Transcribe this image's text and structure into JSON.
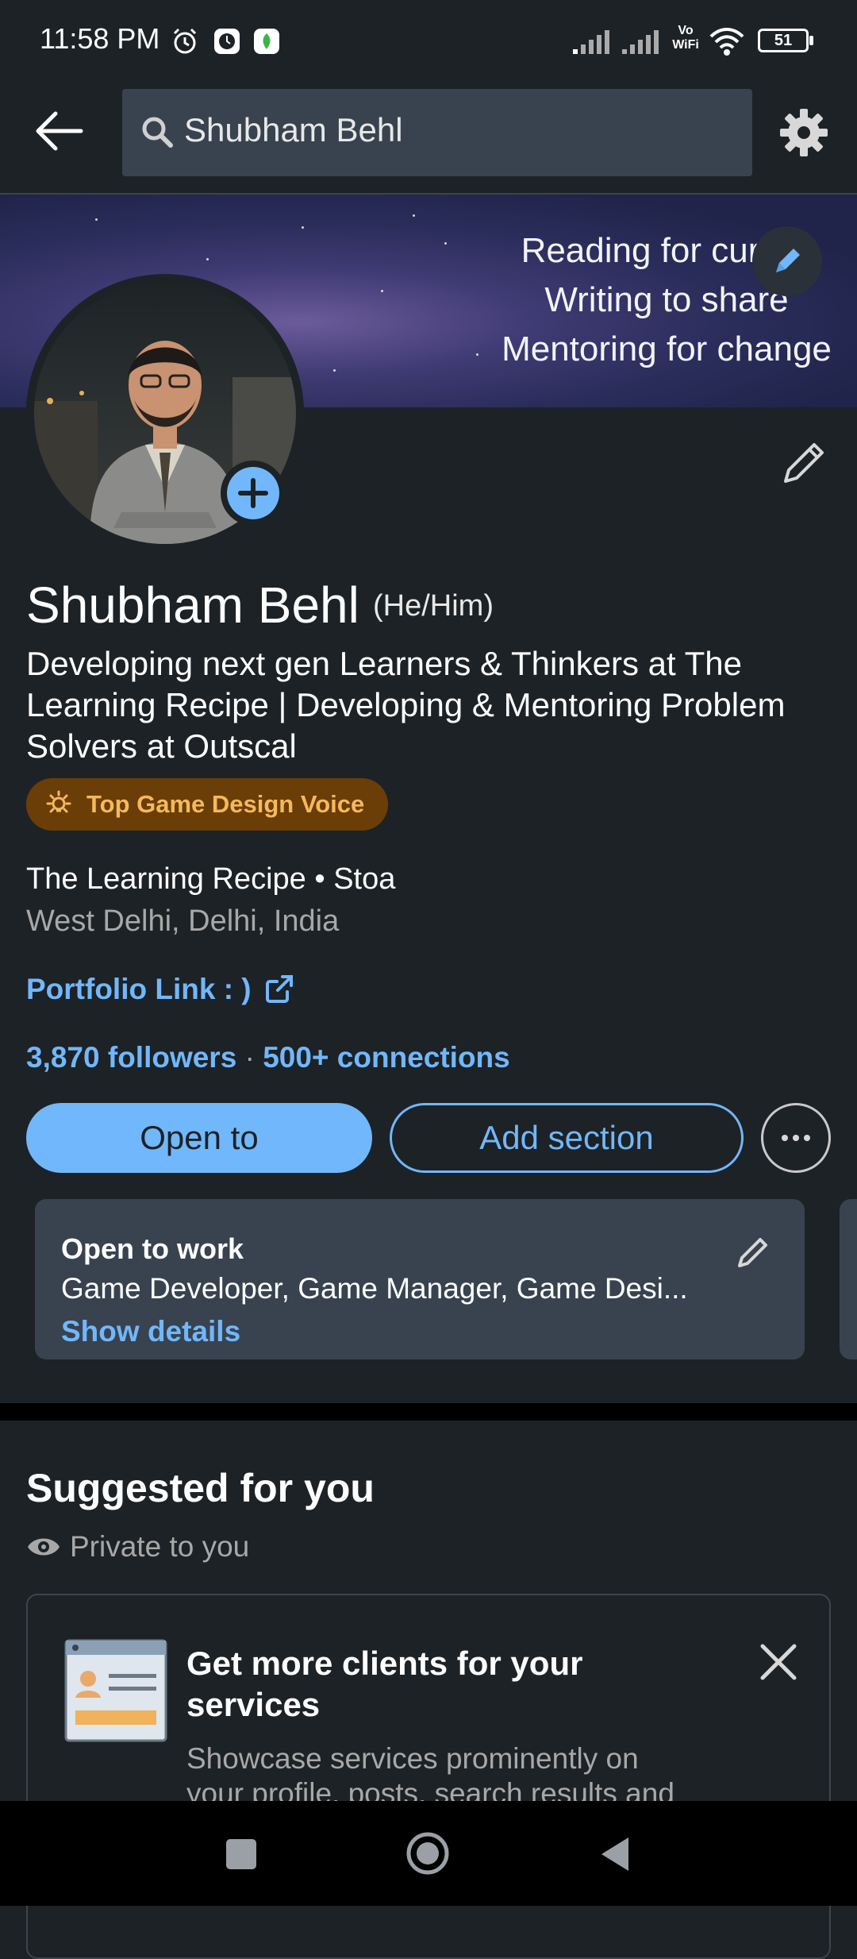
{
  "status_bar": {
    "time": "11:58 PM",
    "battery": "51",
    "vowifi_label": "Vo WiFi"
  },
  "search": {
    "query": "Shubham Behl"
  },
  "banner": {
    "lines": [
      "Reading for curiosi",
      "Writing to share",
      "Mentoring for change"
    ]
  },
  "profile": {
    "name": "Shubham Behl",
    "pronouns": "(He/Him)",
    "headline": "Developing next gen Learners & Thinkers at The Learning Recipe | Developing & Mentoring Problem Solvers at Outscal",
    "badge": "Top Game Design Voice",
    "company": "The Learning Recipe • Stoa",
    "location": "West Delhi, Delhi, India",
    "portfolio": "Portfolio Link : )",
    "followers": "3,870 followers",
    "stats_separator": "·",
    "connections": "500+ connections"
  },
  "actions": {
    "open_to": "Open to",
    "add_section": "Add section"
  },
  "open_to_work": {
    "title": "Open to work",
    "roles": "Game Developer, Game Manager, Game Desi...",
    "show_details": "Show details"
  },
  "suggested": {
    "title": "Suggested for you",
    "privacy": "Private to you",
    "card_title": "Get more clients for your services",
    "card_desc": "Showcase services prominently on your profile, posts, search results and"
  },
  "colors": {
    "background": "#1d2226",
    "accent": "#71b7fb",
    "card": "#38434f",
    "badge_bg": "#6b3e07",
    "badge_text": "#f5b95c"
  }
}
